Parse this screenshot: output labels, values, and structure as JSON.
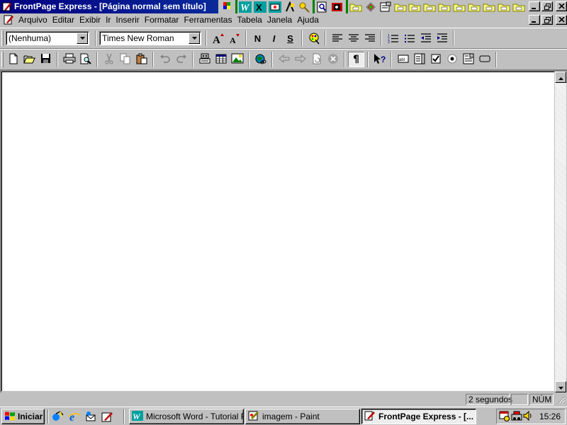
{
  "window": {
    "title": "FrontPage Express - [Página normal sem título]",
    "controls": [
      "minimize",
      "restore",
      "close"
    ],
    "document_controls": [
      "minimize",
      "restore",
      "close"
    ]
  },
  "office_shortcut_bar": {
    "icons": [
      "office-logo-icon",
      "word-icon",
      "excel-icon",
      "powerpoint-icon",
      "access-icon",
      "keys-icon",
      "find-icon",
      "binder-icon",
      "folder-icon",
      "palette-icon",
      "notes-icon",
      "folder-icon",
      "folder-icon",
      "folder-icon",
      "folder-icon",
      "folder-icon",
      "folder-icon",
      "folder-icon",
      "folder-icon"
    ]
  },
  "menu": {
    "items": [
      {
        "id": "arquivo",
        "label": "Arquivo"
      },
      {
        "id": "editar",
        "label": "Editar"
      },
      {
        "id": "exibir",
        "label": "Exibir"
      },
      {
        "id": "ir",
        "label": "Ir"
      },
      {
        "id": "inserir",
        "label": "Inserir"
      },
      {
        "id": "formatar",
        "label": "Formatar"
      },
      {
        "id": "ferramentas",
        "label": "Ferramentas"
      },
      {
        "id": "tabela",
        "label": "Tabela"
      },
      {
        "id": "janela",
        "label": "Janela"
      },
      {
        "id": "ajuda",
        "label": "Ajuda"
      }
    ]
  },
  "format_toolbar": {
    "style_value": "(Nenhuma)",
    "font_value": "Times New Roman",
    "bold_label": "N",
    "italic_label": "I",
    "underline_label": "S"
  },
  "standard_toolbar": {
    "show_all_pressed": true
  },
  "statusbar": {
    "load_time": "2 segundos",
    "num_lock": "NÚM"
  },
  "taskbar": {
    "start_label": "Iniciar",
    "tasks": [
      {
        "label": "Microsoft Word - Tutorial F...",
        "icon": "word-icon",
        "active": false
      },
      {
        "label": "imagem - Paint",
        "icon": "paint-icon",
        "active": false
      },
      {
        "label": "FrontPage Express - [...",
        "icon": "frontpage-icon",
        "active": true
      }
    ],
    "clock": "15:26"
  },
  "colors": {
    "titlebar_active": "#000080",
    "face": "#c0c0c0",
    "page_background": "#ffffff"
  }
}
